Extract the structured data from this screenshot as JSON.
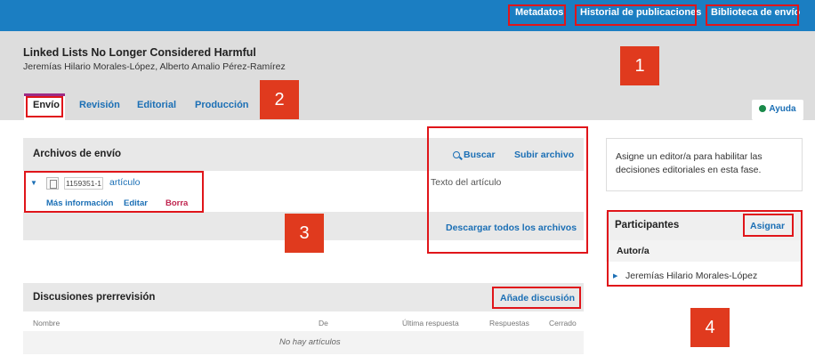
{
  "topbar": {
    "links": [
      "Metadatos",
      "Historial de publicaciones",
      "Biblioteca de envío"
    ]
  },
  "submission": {
    "title": "Linked Lists No Longer Considered Harmful",
    "authors": "Jeremías Hilario Morales-López, Alberto Amalio Pérez-Ramírez"
  },
  "tabs": [
    "Envío",
    "Revisión",
    "Editorial",
    "Producción"
  ],
  "help_label": "Ayuda",
  "files_panel": {
    "heading": "Archivos de envío",
    "search_label": "Buscar",
    "upload_label": "Subir archivo",
    "file": {
      "id": "1159351-1",
      "name": "artículo",
      "type_text": "Texto del artículo",
      "actions": [
        "Más información",
        "Editar",
        "Borra"
      ]
    },
    "download_all_label": "Descargar todos los archivos"
  },
  "discussions_panel": {
    "heading": "Discusiones prerrevisión",
    "add_label": "Añade discusión",
    "columns": [
      "Nombre",
      "De",
      "Última respuesta",
      "Respuestas",
      "Cerrado"
    ],
    "empty_text": "No hay artículos"
  },
  "editor_notice": "Asigne un editor/a para habilitar las decisiones editoriales en esta fase.",
  "participants": {
    "heading": "Participantes",
    "assign_label": "Asignar",
    "role": "Autor/a",
    "members": [
      "Jeremías Hilario Morales-López"
    ]
  },
  "callouts": [
    "1",
    "2",
    "3",
    "4"
  ],
  "colors": {
    "topbar": "#1b7ec2",
    "link": "#1b6fb5",
    "highlight": "#e0151a",
    "callout": "#e03a1e",
    "active_tab_border": "#9c2b86",
    "delete_link": "#c0254f"
  },
  "icons": {
    "search": "search-icon",
    "help": "help-circle-icon",
    "expand": "triangle-icon",
    "file": "file-icon"
  }
}
